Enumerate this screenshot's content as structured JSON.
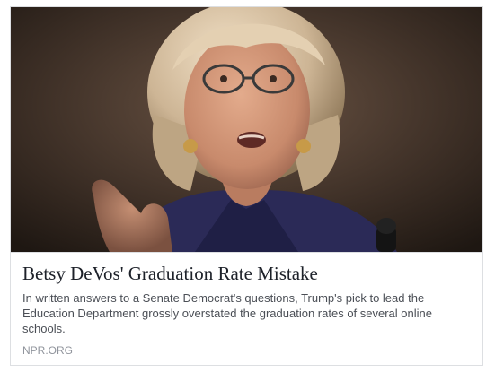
{
  "link_preview": {
    "headline": "Betsy DeVos' Graduation Rate Mistake",
    "description": "In written answers to a Senate Democrat's questions, Trump's pick to lead the Education Department grossly overstated the graduation rates of several online schools.",
    "source": "NPR.ORG"
  }
}
